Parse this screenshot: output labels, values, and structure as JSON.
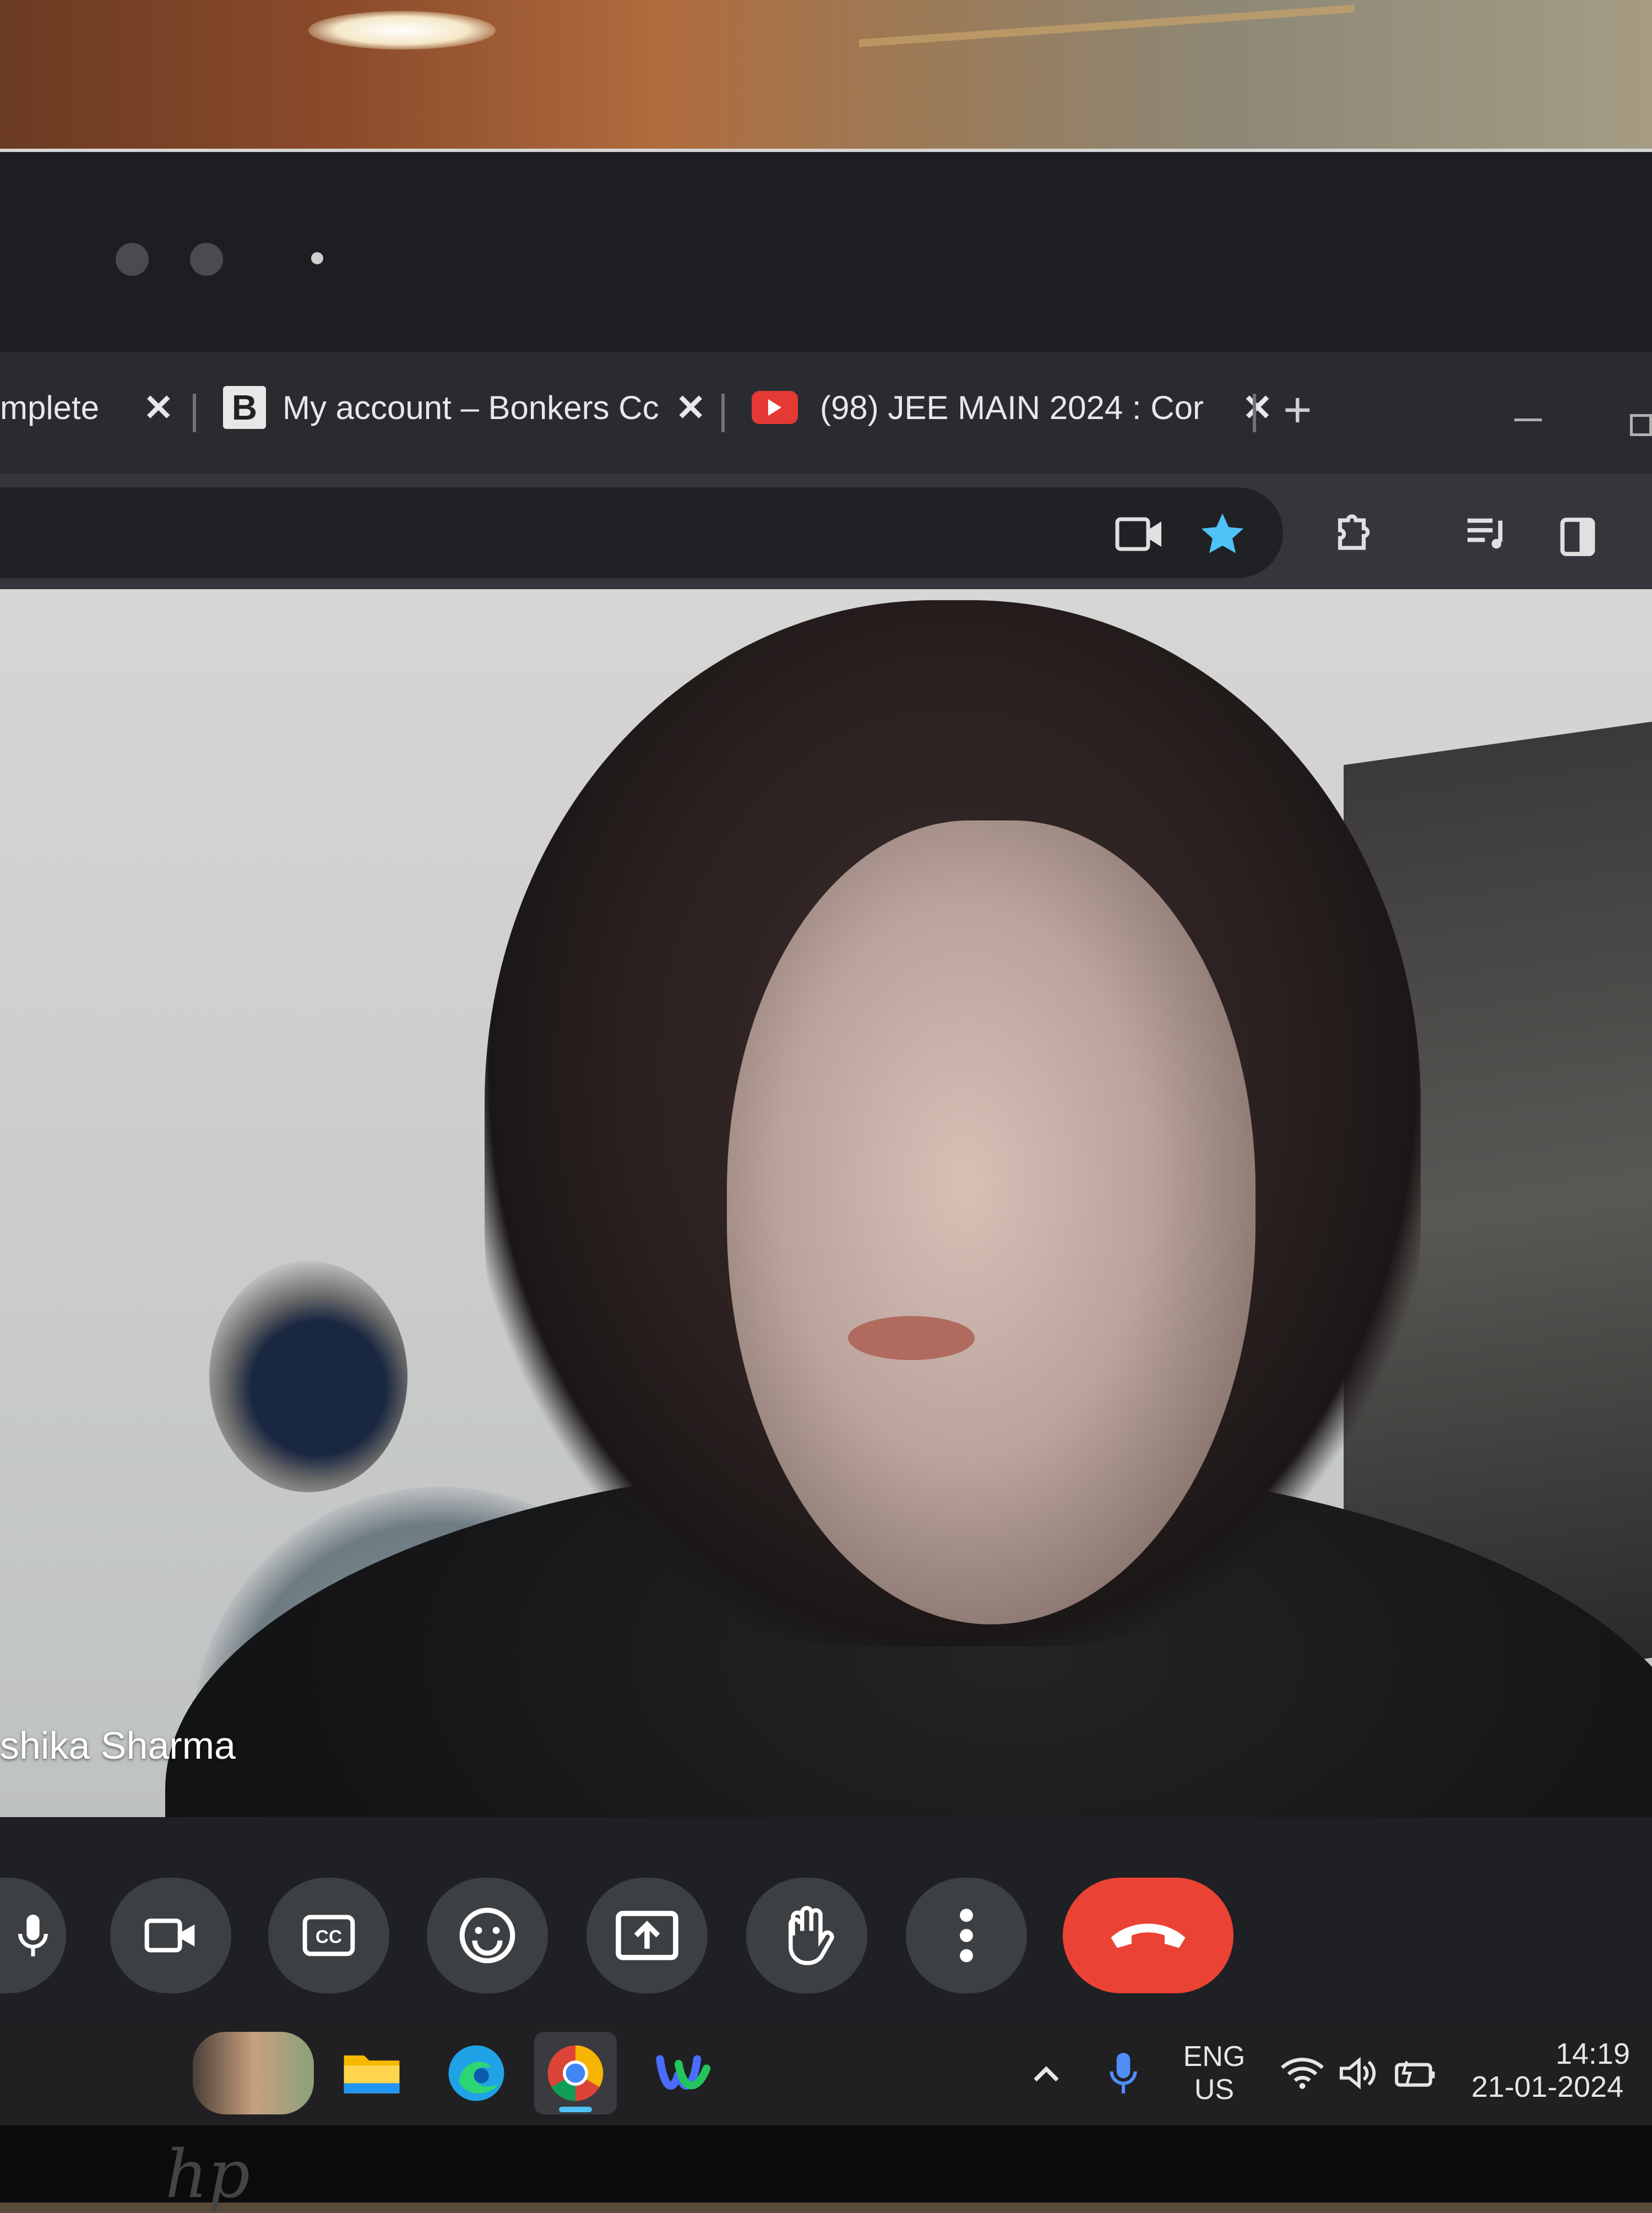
{
  "browser": {
    "tabs": [
      {
        "label": "mplete",
        "close": "✕"
      },
      {
        "label": "My account – Bonkers Cc",
        "favicon": "B",
        "close": "✕"
      },
      {
        "label": "(98) JEE MAIN 2024 : Cor",
        "close": "✕"
      }
    ],
    "new_tab": "+"
  },
  "meet": {
    "participant_name": "shika Sharma"
  },
  "taskbar": {
    "language": "ENG",
    "region": "US",
    "time": "14:19",
    "date": "21-01-2024"
  },
  "colors": {
    "end_call": "#ea4335",
    "bookmark_star": "#4fc3f7",
    "youtube": "#e53935",
    "edge": "#1fa3e6"
  },
  "icons": [
    "bonkers-favicon",
    "youtube-icon",
    "close-icon",
    "new-tab-icon",
    "camera-icon",
    "star-icon",
    "extensions-icon",
    "media-control-icon",
    "side-panel-icon",
    "mic-icon",
    "camera-toggle-icon",
    "captions-icon",
    "emoji-icon",
    "present-icon",
    "raise-hand-icon",
    "more-options-icon",
    "end-call-icon",
    "widget-icon",
    "file-explorer-icon",
    "edge-icon",
    "chrome-icon",
    "webex-icon",
    "chevron-up-icon",
    "tray-mic-icon",
    "wifi-icon",
    "volume-icon",
    "battery-icon"
  ]
}
